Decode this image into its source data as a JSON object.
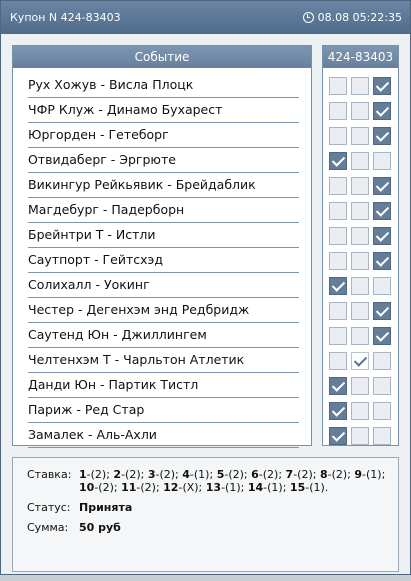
{
  "window": {
    "title": "Купон N 424-83403",
    "datetime": "08.08 05:22:35"
  },
  "events_header": "Событие",
  "picks_header": "424-83403",
  "events": [
    "Рух Хожув - Висла Плоцк",
    "ЧФР Клуж - Динамо Бухарест",
    "Юргорден - Гетеборг",
    "Отвидаберг - Эргрюте",
    "Викингур Рейкьявик - Брейдаблик",
    "Магдебург - Падерборн",
    "Брейнтри Т - Истли",
    "Саутпорт - Гейтсхэд",
    "Солихалл - Уокинг",
    "Честер - Дегенхэм энд Редбридж",
    "Саутенд Юн - Джиллингем",
    "Челтенхэм Т - Чарльтон Атлетик",
    "Данди Юн - Партик Тистл",
    "Париж - Ред Стар",
    "Замалек - Аль-Ахли"
  ],
  "picks": [
    [
      false,
      false,
      true
    ],
    [
      false,
      false,
      true
    ],
    [
      false,
      false,
      true
    ],
    [
      true,
      false,
      false
    ],
    [
      false,
      false,
      true
    ],
    [
      false,
      false,
      true
    ],
    [
      false,
      false,
      true
    ],
    [
      false,
      false,
      true
    ],
    [
      true,
      false,
      false
    ],
    [
      false,
      false,
      true
    ],
    [
      false,
      false,
      true
    ],
    [
      false,
      true,
      false
    ],
    [
      true,
      false,
      false
    ],
    [
      true,
      false,
      false
    ],
    [
      true,
      false,
      false
    ]
  ],
  "summary": {
    "stake_label": "Ставка:",
    "stake": [
      [
        "1",
        "-(2); "
      ],
      [
        "2",
        "-(2); "
      ],
      [
        "3",
        "-(2); "
      ],
      [
        "4",
        "-(1); "
      ],
      [
        "5",
        "-(2); "
      ],
      [
        "6",
        "-(2); "
      ],
      [
        "7",
        "-(2); "
      ],
      [
        "8",
        "-(2); "
      ],
      [
        "9",
        "-(1); "
      ],
      [
        "10",
        "-(2); "
      ],
      [
        "11",
        "-(2); "
      ],
      [
        "12",
        "-(X); "
      ],
      [
        "13",
        "-(1); "
      ],
      [
        "14",
        "-(1); "
      ],
      [
        "15",
        "-(1)."
      ]
    ],
    "status_label": "Статус:",
    "status": "Принята",
    "sum_label": "Сумма:",
    "sum": "50 руб"
  },
  "colors": {
    "accent": "#647d99",
    "titlebar": "#5a7596"
  }
}
